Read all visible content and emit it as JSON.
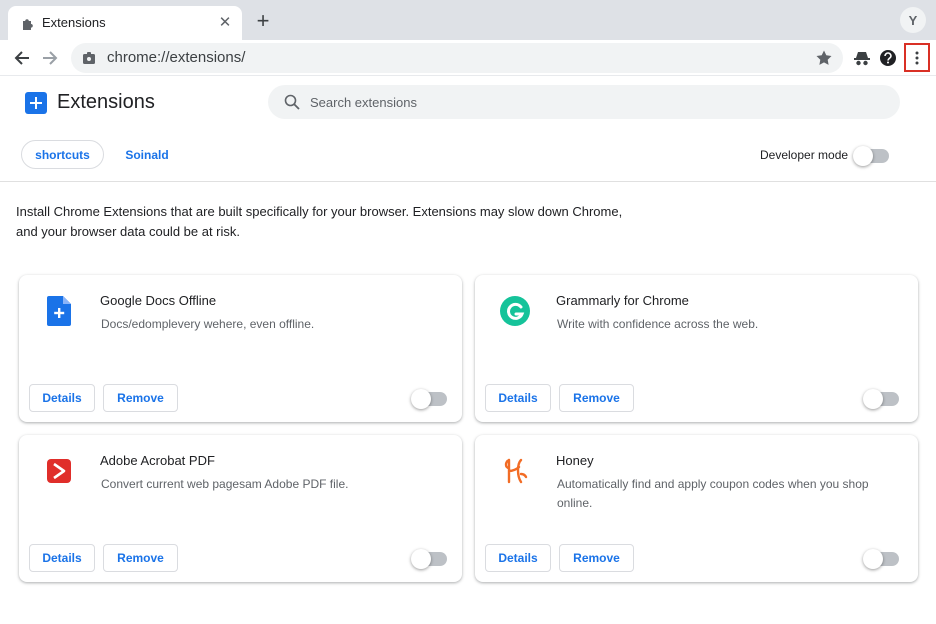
{
  "browser": {
    "tab": {
      "title": "Extensions",
      "close_glyph": "✕"
    },
    "newtab_glyph": "+",
    "profile_initial": "Y",
    "address": "chrome://extensions/"
  },
  "header": {
    "title": "Extensions",
    "search_placeholder": "Search extensions"
  },
  "chips": {
    "shortcuts": "shortcuts",
    "second": "Soinald"
  },
  "developer_mode": {
    "label": "Developer mode",
    "enabled": false
  },
  "notice": {
    "line1": "Install Chrome Extensions that are built specifically for your browser. Extensions may slow down Chrome,",
    "line2": "and your browser data could be at risk."
  },
  "extensions": [
    {
      "name": "Google Docs Offline",
      "description": "Docs/edomplevery wehere, even offline.",
      "enabled": false,
      "icon": "google-docs-icon",
      "details": "Details",
      "remove": "Remove"
    },
    {
      "name": "Grammarly for Chrome",
      "description": "Write with confidence across the web.",
      "enabled": false,
      "icon": "grammarly-icon",
      "details": "Details",
      "remove": "Remove"
    },
    {
      "name": "Adobe Acrobat PDF",
      "description": "Convert current web pagesam Adobe PDF file.",
      "enabled": false,
      "icon": "adobe-acrobat-icon",
      "details": "Details",
      "remove": "Remove"
    },
    {
      "name": "Honey",
      "description": "Automatically find and apply coupon codes when you shop online.",
      "enabled": false,
      "icon": "honey-icon",
      "details": "Details",
      "remove": "Remove"
    }
  ],
  "colors": {
    "accent": "#1a73e8",
    "menu_highlight": "#d93025",
    "toggle_off": "#bdc1c6"
  }
}
